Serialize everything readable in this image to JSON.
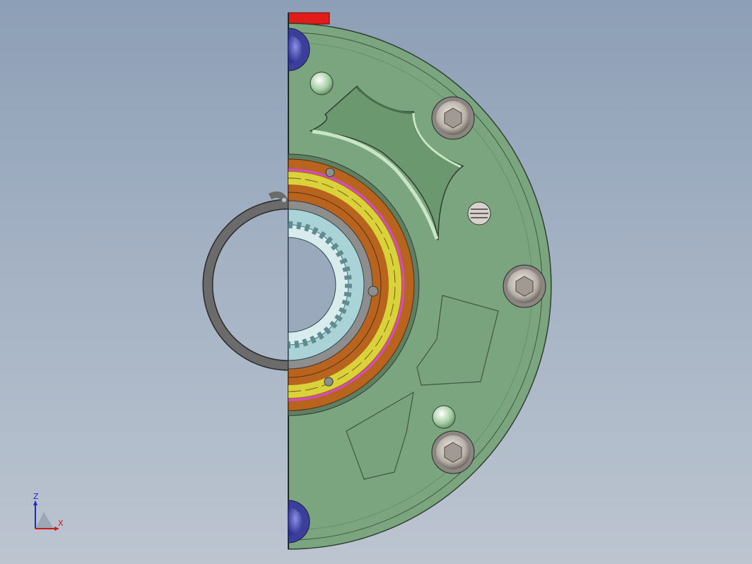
{
  "viewport": {
    "background_top": "#8d9fb6",
    "background_bottom": "#bcc5d0"
  },
  "model": {
    "colors": {
      "housing": "#7aa57e",
      "housing_edge": "#2f3f30",
      "slot_highlight": "#c8e6c4",
      "bearing_outer": "#b8641e",
      "bearing_balls": "#d9d23a",
      "seal_magenta": "#d04bd0",
      "hub": "#a9d3d6",
      "snap_ring": "#6b6b6b",
      "bolt": "#c9c2bb",
      "dowel": "#d8d2cc",
      "end_bolt": "#4a4ea8",
      "red_tab": "#e11a1a"
    },
    "parts": [
      "housing-half",
      "retaining-snap-ring",
      "ball-bearing",
      "splined-hub",
      "socket-head-bolt",
      "dowel-pin",
      "threaded-plug"
    ]
  },
  "triad": {
    "z_label": "Z",
    "x_label": "X",
    "z_color": "#1a2acc",
    "x_color": "#cc1a1a"
  }
}
